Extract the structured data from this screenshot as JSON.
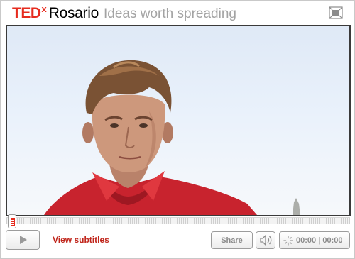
{
  "header": {
    "brand_ted": "TED",
    "brand_x": "x",
    "event_name": "Rosario",
    "tagline": "Ideas worth spreading"
  },
  "controls": {
    "subtitles_label": "View subtitles",
    "share_label": "Share",
    "time_elapsed": "00:00",
    "time_separator": "|",
    "time_total": "00:00",
    "progress_fraction": 0
  },
  "icons": {
    "fullscreen": "fullscreen-icon",
    "play": "play-icon",
    "volume": "speaker-icon",
    "clock": "loading-clock-icon"
  },
  "colors": {
    "brand_red": "#e62b1e",
    "subtitles_red": "#c0251b",
    "tagline_gray": "#a3a3a3",
    "control_text_gray": "#8a8a8a"
  }
}
